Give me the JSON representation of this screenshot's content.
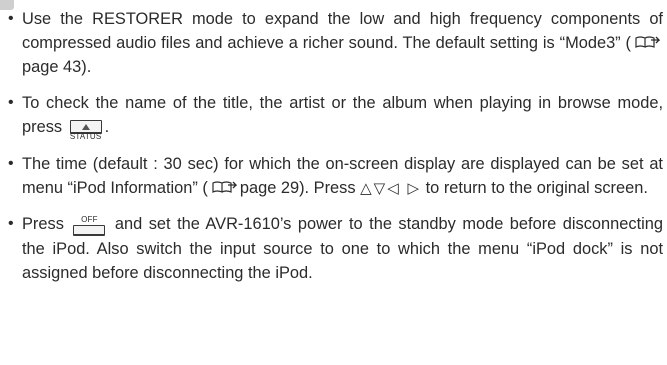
{
  "notes": [
    {
      "text_before": "Use the RESTORER mode to expand the low and high frequency components of compressed audio files and achieve a richer sound. The default setting is “Mode3” (",
      "ref_page": "page 43",
      "text_after": ")."
    },
    {
      "text_before": "To check the name of the title, the artist or the album when playing in browse mode, press ",
      "key_label": "STATUS",
      "text_after": "."
    },
    {
      "text_before": "The time (default : 30 sec) for which the on-screen display are displayed can be set at menu “iPod Information” (",
      "ref_page": "page 29",
      "text_middle": "). Press ",
      "arrows": "△▽◁ ▷",
      "text_after": " to return to the original screen."
    },
    {
      "text_before": "Press ",
      "key_label": "OFF",
      "text_after": " and set the AVR-1610’s power to the standby mode before disconnecting the iPod. Also switch the input source to one to which the menu “iPod dock” is not assigned before disconnecting the iPod."
    }
  ],
  "icons": {
    "bullet": "bullet-icon",
    "reference": "reference-book-icon",
    "corner": "note-marker-icon"
  }
}
